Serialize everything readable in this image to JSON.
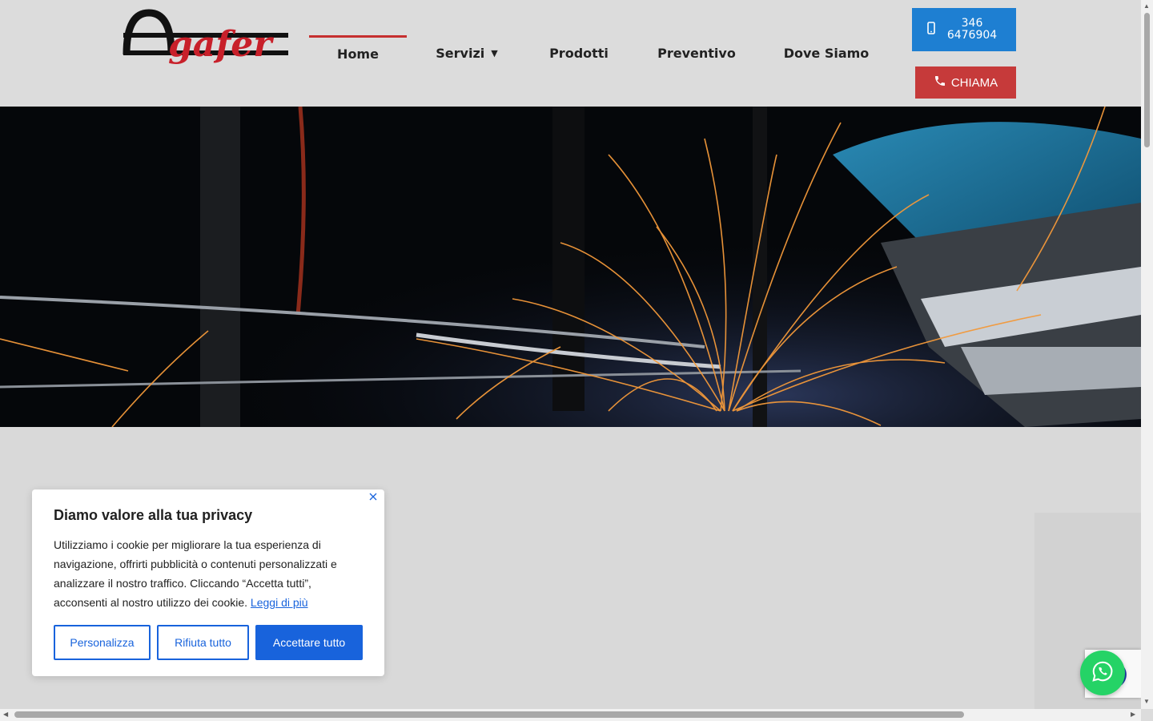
{
  "brand": {
    "logo_text": "Agafer",
    "logo_color": "#c8202a"
  },
  "nav": {
    "items": [
      {
        "label": "Home",
        "active": true
      },
      {
        "label": "Servizi",
        "has_dropdown": true
      },
      {
        "label": "Prodotti"
      },
      {
        "label": "Preventivo"
      },
      {
        "label": "Dove Siamo"
      }
    ]
  },
  "contact": {
    "phone_label": "346 6476904",
    "call_label": "CHIAMA",
    "phone_btn_color": "#1e7fd2",
    "call_btn_color": "#c63a3a"
  },
  "hero": {
    "icon": "welding-sparks-photo"
  },
  "cookie": {
    "title": "Diamo valore alla tua privacy",
    "body": "Utilizziamo i cookie per migliorare la tua esperienza di navigazione, offrirti pubblicità o contenuti personalizzati e analizzare il nostro traffico. Cliccando “Accetta tutti”, acconsenti al nostro utilizzo dei cookie.",
    "read_more": "Leggi di più",
    "btn_customize": "Personalizza",
    "btn_reject": "Rifiuta tutto",
    "btn_accept": "Accettare tutto",
    "accent": "#1863dc"
  },
  "widgets": {
    "whatsapp_icon": "whatsapp-icon",
    "whatsapp_color": "#25d366"
  }
}
